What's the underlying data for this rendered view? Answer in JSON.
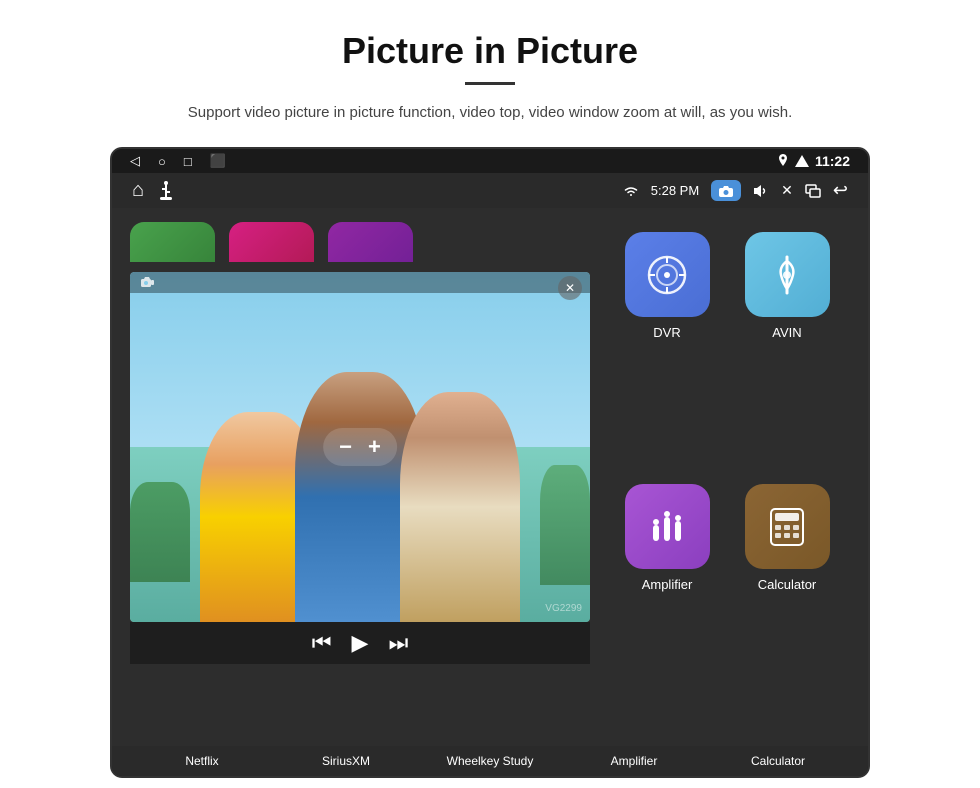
{
  "page": {
    "title": "Picture in Picture",
    "subtitle": "Support video picture in picture function, video top, video window zoom at will, as you wish.",
    "divider": true
  },
  "status_bar": {
    "time": "11:22",
    "back_icon": "◁",
    "home_icon": "○",
    "recents_icon": "□",
    "media_icon": "⬛"
  },
  "app_bar": {
    "home_icon": "⌂",
    "usb_icon": "↑",
    "wifi_icon": "WiFi",
    "time": "5:28 PM",
    "camera_icon": "📷",
    "volume_icon": "🔊",
    "close_icon": "✕",
    "window_icon": "⧉",
    "back_icon": "↩"
  },
  "pip": {
    "cam_icon": "📷",
    "minus": "−",
    "plus": "+",
    "close": "✕",
    "prev": "⏮",
    "next": "⏭"
  },
  "partial_apps": [
    {
      "color": "green",
      "label": ""
    },
    {
      "color": "pink",
      "label": ""
    },
    {
      "color": "purple",
      "label": ""
    }
  ],
  "app_grid": [
    {
      "id": "dvr",
      "label": "DVR",
      "color_class": "app-icon-dvr",
      "icon": "dvr"
    },
    {
      "id": "avin",
      "label": "AVIN",
      "color_class": "app-icon-avin",
      "icon": "avin"
    },
    {
      "id": "amplifier",
      "label": "Amplifier",
      "color_class": "app-icon-amplifier",
      "icon": "amplifier"
    },
    {
      "id": "calculator",
      "label": "Calculator",
      "color_class": "app-icon-calculator",
      "icon": "calculator"
    }
  ],
  "bottom_labels": [
    {
      "label": "Netflix"
    },
    {
      "label": "SiriusXM"
    },
    {
      "label": "Wheelkey Study"
    },
    {
      "label": "Amplifier"
    },
    {
      "label": "Calculator"
    }
  ]
}
